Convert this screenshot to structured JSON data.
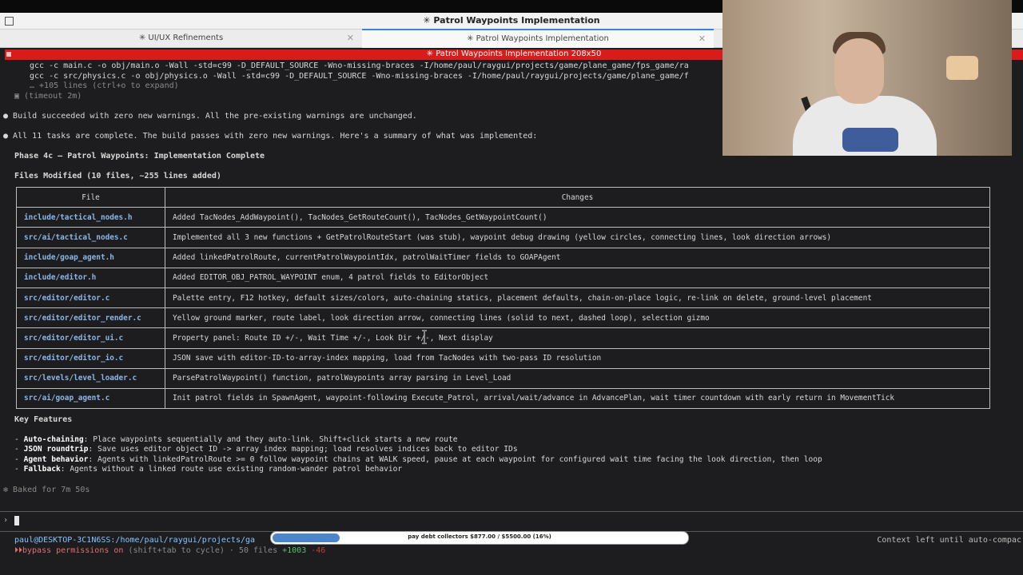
{
  "window": {
    "title": "✳ Patrol Waypoints Implementation"
  },
  "tabs": [
    {
      "label": "✳ UI/UX Refinements"
    },
    {
      "label": "✳ Patrol Waypoints Implementation"
    }
  ],
  "terminal_title": "✳ Patrol Waypoints Implementation 208x50",
  "log": {
    "gcc1": "gcc -c main.c -o obj/main.o -Wall -std=c99 -D_DEFAULT_SOURCE -Wno-missing-braces -I/home/paul/raygui/projects/game/plane_game/fps_game/ra",
    "gcc2": "gcc -c src/physics.c -o obj/physics.o -Wall -std=c99 -D_DEFAULT_SOURCE -Wno-missing-braces -I/home/paul/raygui/projects/game/plane_game/f",
    "more": "… +105 lines (ctrl+o to expand)",
    "timeout": "(timeout 2m)",
    "build_msg": "Build succeeded with zero new warnings. All the pre-existing warnings are unchanged.",
    "summary": "All 11 tasks are complete. The build passes with zero new warnings. Here's a summary of what was implemented:",
    "phase": "Phase 4c — Patrol Waypoints: Implementation Complete",
    "files_modified": "Files Modified (10 files, ~255 lines added)"
  },
  "table": {
    "headers": [
      "File",
      "Changes"
    ],
    "rows": [
      {
        "file": "include/tactical_nodes.h",
        "changes": "Added TacNodes_AddWaypoint(), TacNodes_GetRouteCount(), TacNodes_GetWaypointCount()"
      },
      {
        "file": "src/ai/tactical_nodes.c",
        "changes": "Implemented all 3 new functions + GetPatrolRouteStart (was stub), waypoint debug drawing (yellow circles, connecting lines, look direction arrows)"
      },
      {
        "file": "include/goap_agent.h",
        "changes": "Added linkedPatrolRoute, currentPatrolWaypointIdx, patrolWaitTimer fields to GOAPAgent"
      },
      {
        "file": "include/editor.h",
        "changes": "Added EDITOR_OBJ_PATROL_WAYPOINT enum, 4 patrol fields to EditorObject"
      },
      {
        "file": "src/editor/editor.c",
        "changes": "Palette entry, F12 hotkey, default sizes/colors, auto-chaining statics, placement defaults, chain-on-place logic, re-link on delete, ground-level placement"
      },
      {
        "file": "src/editor/editor_render.c",
        "changes": "Yellow ground marker, route label, look direction arrow, connecting lines (solid to next, dashed loop), selection gizmo"
      },
      {
        "file": "src/editor/editor_ui.c",
        "changes": "Property panel: Route ID +/-, Wait Time +/-, Look Dir +/-, Next display"
      },
      {
        "file": "src/editor/editor_io.c",
        "changes": "JSON save with editor-ID-to-array-index mapping, load from TacNodes with two-pass ID resolution"
      },
      {
        "file": "src/levels/level_loader.c",
        "changes": "ParsePatrolWaypoint() function, patrolWaypoints array parsing in Level_Load"
      },
      {
        "file": "src/ai/goap_agent.c",
        "changes": "Init patrol fields in SpawnAgent, waypoint-following Execute_Patrol, arrival/wait/advance in AdvancePlan, wait timer countdown with early return in MovementTick"
      }
    ]
  },
  "features": {
    "heading": "Key Features",
    "items": [
      {
        "key": "Auto-chaining",
        "text": ": Place waypoints sequentially and they auto-link. Shift+click starts a new route"
      },
      {
        "key": "JSON roundtrip",
        "text": ": Save uses editor object ID -> array index mapping; load resolves indices back to editor IDs"
      },
      {
        "key": "Agent behavior",
        "text": ": Agents with linkedPatrolRoute >= 0 follow waypoint chains at WALK speed, pause at each waypoint for configured wait time facing the look direction, then loop"
      },
      {
        "key": "Fallback",
        "text": ": Agents without a linked route use existing random-wander patrol behavior"
      }
    ]
  },
  "baked": "✻ Baked for 7m 50s",
  "prompt": {
    "caret": "›"
  },
  "status": {
    "path": "paul@DESKTOP-3C1N6SS:/home/paul/raygui/projects/ga",
    "permissions": "bypass permissions on",
    "cycle_hint": " (shift+tab to cycle) · 50 files ",
    "plus": "+1003",
    "minus": " -46",
    "context": "Context left until auto-compac"
  },
  "progress": {
    "label": "pay debt collectors $877.00 / $5500.00 (16%)",
    "fraction": 0.16
  }
}
